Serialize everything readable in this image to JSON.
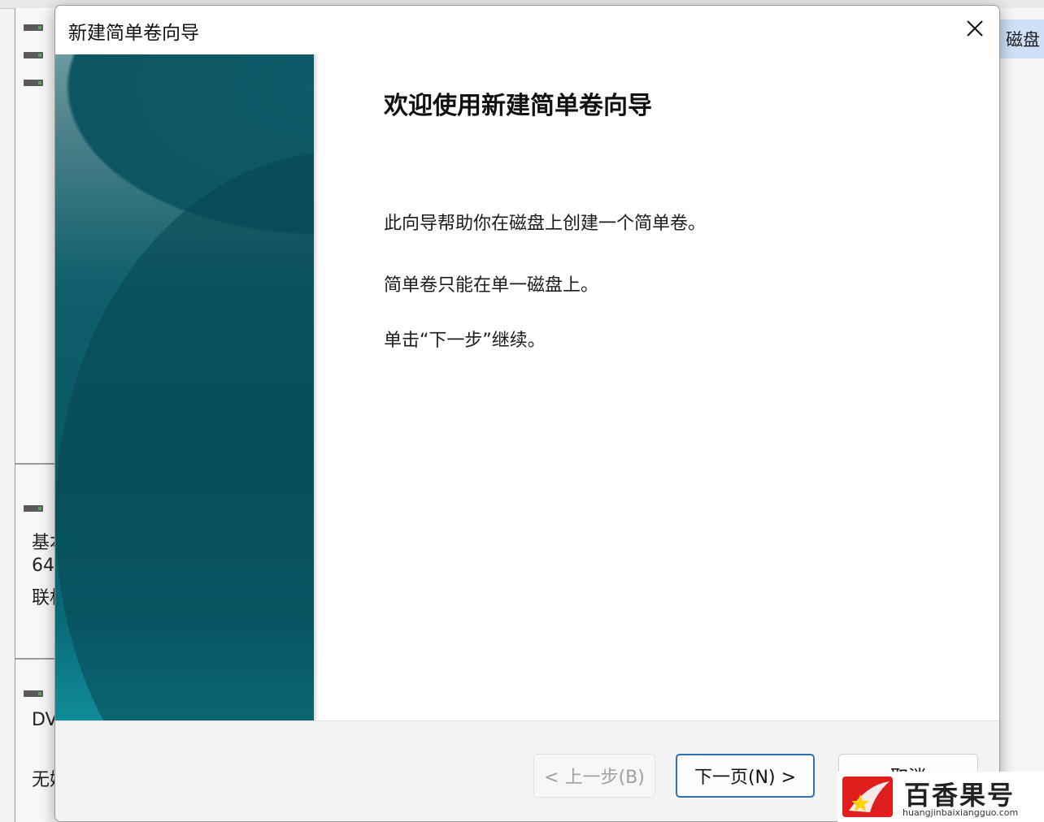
{
  "background_window": {
    "left_pane_text": [
      "基本",
      "64",
      "联机",
      "DV",
      "无媒"
    ],
    "right_action_label": "磁盘"
  },
  "dialog": {
    "title": "新建简单卷向导",
    "close_icon": "close-icon",
    "heading": "欢迎使用新建简单卷向导",
    "paragraphs": [
      "此向导帮助你在磁盘上创建一个简单卷。",
      "简单卷只能在单一磁盘上。",
      "单击“下一步”继续。"
    ],
    "buttons": {
      "back": "< 上一步(B)",
      "next": "下一页(N) >",
      "cancel": "取消"
    },
    "colors": {
      "banner": "#0b5866",
      "default_button_border": "#2e6fb8"
    }
  },
  "watermark": {
    "name": "百香果号",
    "url": "huangjinbaixiangguo.com"
  }
}
